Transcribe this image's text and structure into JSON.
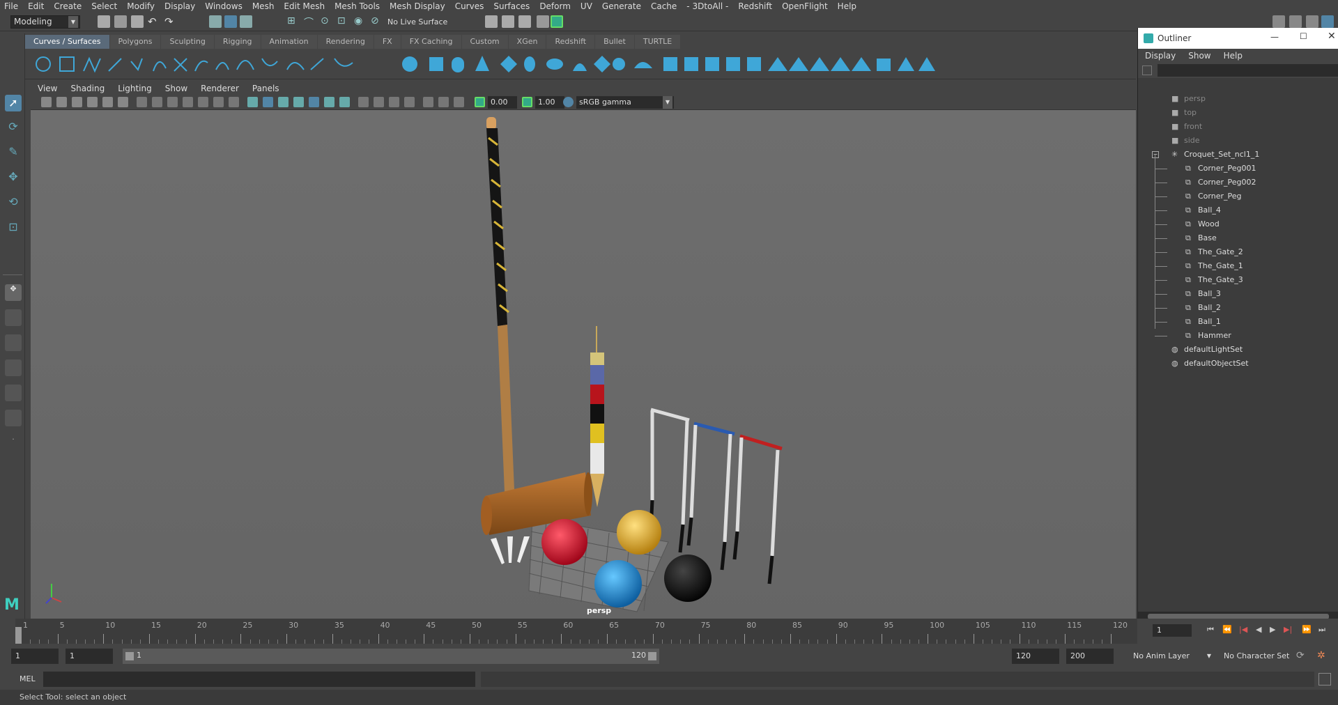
{
  "menubar": [
    "File",
    "Edit",
    "Create",
    "Select",
    "Modify",
    "Display",
    "Windows",
    "Mesh",
    "Edit Mesh",
    "Mesh Tools",
    "Mesh Display",
    "Curves",
    "Surfaces",
    "Deform",
    "UV",
    "Generate",
    "Cache",
    "- 3DtoAll -",
    "Redshift",
    "OpenFlight",
    "Help"
  ],
  "status": {
    "mode": "Modeling",
    "live_surface": "No Live Surface"
  },
  "shelf_tabs": [
    "Curves / Surfaces",
    "Polygons",
    "Sculpting",
    "Rigging",
    "Animation",
    "Rendering",
    "FX",
    "FX Caching",
    "Custom",
    "XGen",
    "Redshift",
    "Bullet",
    "TURTLE"
  ],
  "panel_menu": [
    "View",
    "Shading",
    "Lighting",
    "Show",
    "Renderer",
    "Panels"
  ],
  "panel_bar": {
    "exposure": "0.00",
    "gamma": "1.00",
    "color_space": "sRGB gamma"
  },
  "viewport": {
    "camera_label": "persp"
  },
  "outliner": {
    "title": "Outliner",
    "menu": [
      "Display",
      "Show",
      "Help"
    ],
    "cameras": [
      "persp",
      "top",
      "front",
      "side"
    ],
    "group": "Croquet_Set_ncl1_1",
    "children": [
      "Corner_Peg001",
      "Corner_Peg002",
      "Corner_Peg",
      "Ball_4",
      "Wood",
      "Base",
      "The_Gate_2",
      "The_Gate_1",
      "The_Gate_3",
      "Ball_3",
      "Ball_2",
      "Ball_1",
      "Hammer"
    ],
    "sets": [
      "defaultLightSet",
      "defaultObjectSet"
    ]
  },
  "timeline": {
    "ticks": [
      "1",
      "5",
      "10",
      "15",
      "20",
      "25",
      "30",
      "35",
      "40",
      "45",
      "50",
      "55",
      "60",
      "65",
      "70",
      "75",
      "80",
      "85",
      "90",
      "95",
      "100",
      "105",
      "110",
      "115",
      "120"
    ],
    "current": "1"
  },
  "range": {
    "start": "1",
    "start2": "1",
    "slider_start": "1",
    "slider_end": "120",
    "end": "120",
    "end2": "200",
    "anim_layer": "No Anim Layer",
    "char_set": "No Character Set"
  },
  "cmd": {
    "label": "MEL"
  },
  "help": "Select Tool: select an object",
  "colors": {
    "accent": "#5285a6",
    "ball_red": "#d8102a",
    "ball_yellow": "#e8b830",
    "ball_blue": "#1e90d8",
    "ball_black": "#151515"
  }
}
